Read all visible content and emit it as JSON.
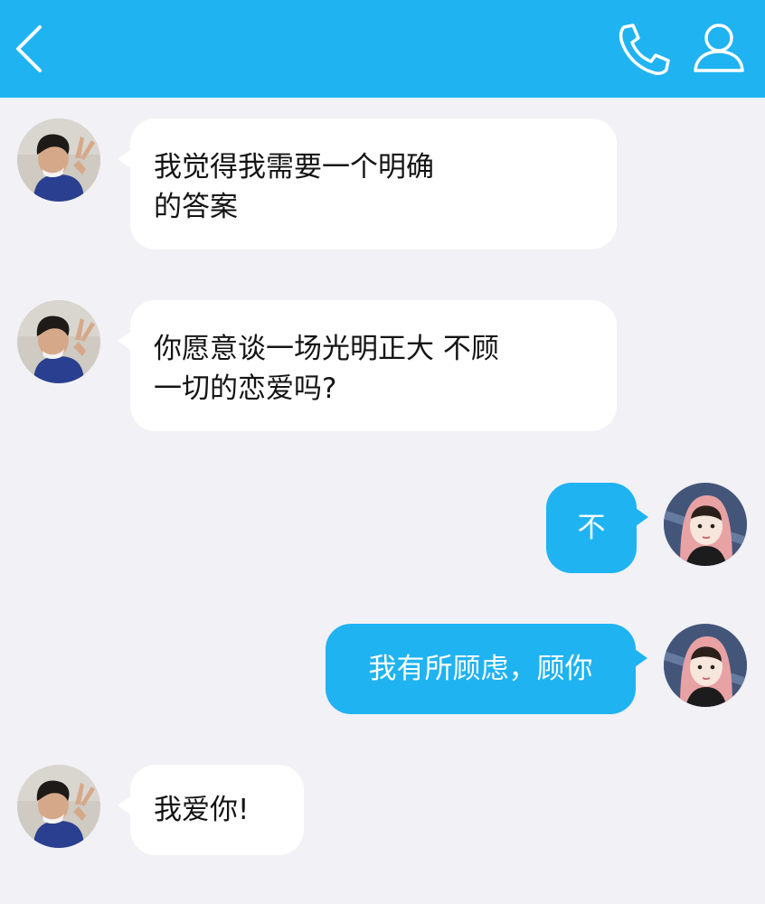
{
  "header": {
    "back_icon": "chevron-left-icon",
    "call_icon": "phone-icon",
    "profile_icon": "person-icon",
    "bar_color": "#1fb3f2"
  },
  "messages": [
    {
      "side": "in",
      "lines": [
        "我觉得我需要一个明确",
        "的答案"
      ]
    },
    {
      "side": "in",
      "lines": [
        "你愿意谈一场光明正大 不顾",
        "一切的恋爱吗?"
      ]
    },
    {
      "side": "out",
      "lines": [
        "不"
      ]
    },
    {
      "side": "out",
      "lines": [
        "我有所顾虑，顾你"
      ]
    },
    {
      "side": "in",
      "lines": [
        "我爱你!"
      ]
    }
  ],
  "colors": {
    "outgoing_bubble": "#1fb3f2",
    "incoming_bubble": "#ffffff",
    "background": "#f1f1f6"
  }
}
